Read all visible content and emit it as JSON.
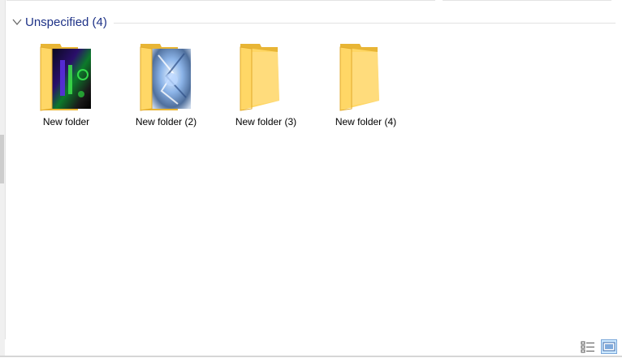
{
  "group": {
    "title": "Unspecified (4)",
    "collapse_icon": "chevron-down-icon"
  },
  "folders": [
    {
      "name": "New folder",
      "preview": "dark-green-purple-image"
    },
    {
      "name": "New folder (2)",
      "preview": "blue-crystal-image"
    },
    {
      "name": "New folder (3)",
      "preview": "empty"
    },
    {
      "name": "New folder (4)",
      "preview": "empty"
    }
  ],
  "statusbar": {
    "details_view_icon": "details-view-icon",
    "large_icons_view_icon": "large-icons-view-icon"
  },
  "colors": {
    "group_title": "#1e3287",
    "folder_back": "#e8b535",
    "folder_front": "#ffd766",
    "selected_view_bg": "#cce8ff"
  }
}
